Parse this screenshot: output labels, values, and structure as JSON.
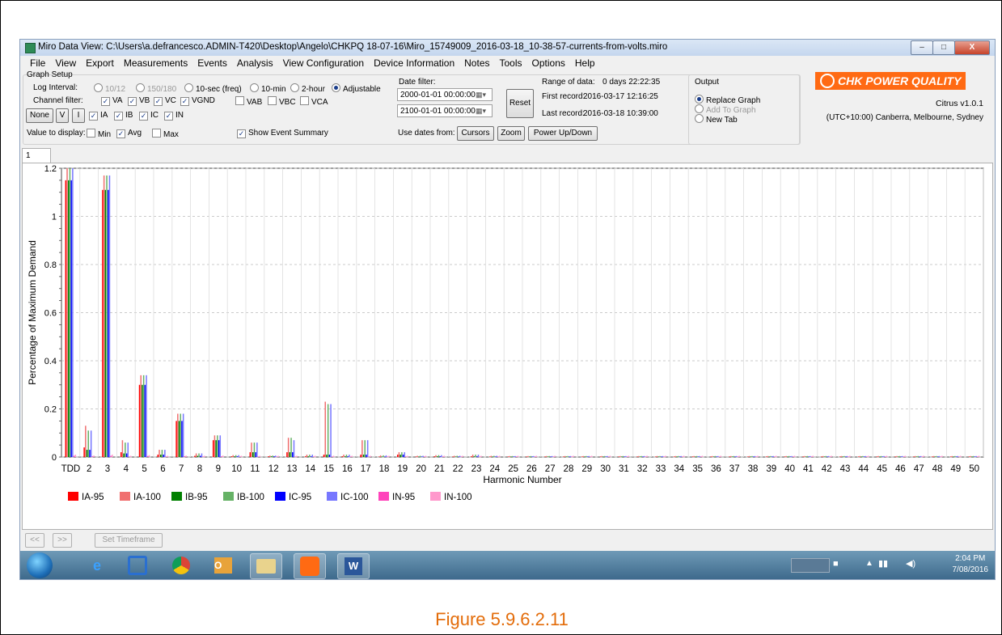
{
  "window": {
    "title": "Miro Data View: C:\\Users\\a.defrancesco.ADMIN-T420\\Desktop\\Angelo\\CHKPQ 18-07-16\\Miro_15749009_2016-03-18_10-38-57-currents-from-volts.miro",
    "min": "–",
    "max": "□",
    "close": "X"
  },
  "menu": [
    "File",
    "View",
    "Export",
    "Measurements",
    "Events",
    "Analysis",
    "View Configuration",
    "Device Information",
    "Notes",
    "Tools",
    "Options",
    "Help"
  ],
  "setup": {
    "group_title": "Graph Setup",
    "log_interval_label": "Log Interval:",
    "log_options": [
      "10/12",
      "150/180",
      "10-sec (freq)",
      "10-min",
      "2-hour",
      "Adjustable"
    ],
    "channel_filter_label": "Channel filter:",
    "channels_row1": [
      "VA",
      "VB",
      "VC",
      "VGND",
      "VAB",
      "VBC",
      "VCA"
    ],
    "channels_row2": [
      "IA",
      "IB",
      "IC",
      "IN"
    ],
    "btn_none": "None",
    "btn_v": "V",
    "btn_i": "I",
    "value_label": "Value to display:",
    "values": [
      "Min",
      "Avg",
      "Max"
    ],
    "show_event_summary": "Show Event Summary",
    "date_filter_label": "Date filter:",
    "date_from": "2000-01-01 00:00:00",
    "date_to": "2100-01-01 00:00:00",
    "reset": "Reset",
    "use_dates_label": "Use dates from:",
    "btn_cursors": "Cursors",
    "btn_zoom": "Zoom",
    "btn_power": "Power Up/Down",
    "range_label": "Range of data:",
    "range_value": "0 days 22:22:35",
    "first_label": "First record:",
    "first_value": "2016-03-17 12:16:25",
    "last_label": "Last record:",
    "last_value": "2016-03-18 10:39:00",
    "output_title": "Output",
    "output_options": [
      "Replace Graph",
      "Add To Graph",
      "New Tab"
    ],
    "logo_text": "CHK POWER QUALITY",
    "version": "Citrus v1.0.1",
    "timezone": "(UTC+10:00) Canberra, Melbourne, Sydney"
  },
  "tab_label": "1",
  "nav": {
    "prev": "<<",
    "next": ">>",
    "set_timeframe": "Set Timeframe"
  },
  "taskbar": {
    "time": "2:04 PM",
    "date": "7/08/2016"
  },
  "caption": "Figure 5.9.6.2.11",
  "colors": {
    "IA-95": "#ff0000",
    "IA-100": "#f07070",
    "IB-95": "#008000",
    "IB-100": "#66b266",
    "IC-95": "#0000ff",
    "IC-100": "#7777ff",
    "IN-95": "#ff44bb",
    "IN-100": "#ff99cc"
  },
  "chart_data": {
    "type": "bar",
    "xlabel": "Harmonic Number",
    "ylabel": "Percentage of Maximum Demand",
    "ylim": [
      0,
      1.2
    ],
    "yticks": [
      0,
      0.2,
      0.4,
      0.6,
      0.8,
      1,
      1.2
    ],
    "categories": [
      "TDD",
      "2",
      "3",
      "4",
      "5",
      "6",
      "7",
      "8",
      "9",
      "10",
      "11",
      "12",
      "13",
      "14",
      "15",
      "16",
      "17",
      "18",
      "19",
      "20",
      "21",
      "22",
      "23",
      "24",
      "25",
      "26",
      "27",
      "28",
      "29",
      "30",
      "31",
      "32",
      "33",
      "34",
      "35",
      "36",
      "37",
      "38",
      "39",
      "40",
      "41",
      "42",
      "43",
      "44",
      "45",
      "46",
      "47",
      "48",
      "49",
      "50"
    ],
    "grid": true,
    "legend_position": "bottom-left",
    "series": [
      {
        "name": "IA-95",
        "values": [
          1.15,
          0.04,
          1.11,
          0.02,
          0.3,
          0.01,
          0.15,
          0.005,
          0.07,
          0.003,
          0.02,
          0.003,
          0.02,
          0.003,
          0.01,
          0.003,
          0.01,
          0.002,
          0.01,
          0.002,
          0.003,
          0.002,
          0.003,
          0.002,
          0.002,
          0.002,
          0.002,
          0.002,
          0.002,
          0.002,
          0.002,
          0.002,
          0.002,
          0.002,
          0.002,
          0.002,
          0.002,
          0.002,
          0.002,
          0.002,
          0.002,
          0.002,
          0.002,
          0.002,
          0.002,
          0.002,
          0.002,
          0.002,
          0.002,
          0.002
        ]
      },
      {
        "name": "IA-100",
        "values": [
          1.2,
          0.13,
          1.17,
          0.07,
          0.34,
          0.03,
          0.18,
          0.015,
          0.09,
          0.008,
          0.06,
          0.006,
          0.08,
          0.01,
          0.23,
          0.01,
          0.07,
          0.007,
          0.02,
          0.005,
          0.008,
          0.005,
          0.01,
          0.005,
          0.004,
          0.004,
          0.004,
          0.004,
          0.004,
          0.004,
          0.004,
          0.004,
          0.004,
          0.004,
          0.004,
          0.004,
          0.004,
          0.004,
          0.004,
          0.004,
          0.004,
          0.004,
          0.004,
          0.004,
          0.004,
          0.004,
          0.004,
          0.004,
          0.004,
          0.004
        ]
      },
      {
        "name": "IB-95",
        "values": [
          1.15,
          0.03,
          1.11,
          0.015,
          0.3,
          0.01,
          0.15,
          0.005,
          0.07,
          0.003,
          0.02,
          0.003,
          0.02,
          0.003,
          0.01,
          0.003,
          0.01,
          0.002,
          0.01,
          0.002,
          0.003,
          0.002,
          0.003,
          0.002,
          0.002,
          0.002,
          0.002,
          0.002,
          0.002,
          0.002,
          0.002,
          0.002,
          0.002,
          0.002,
          0.002,
          0.002,
          0.002,
          0.002,
          0.002,
          0.002,
          0.002,
          0.002,
          0.002,
          0.002,
          0.002,
          0.002,
          0.002,
          0.002,
          0.002,
          0.002
        ]
      },
      {
        "name": "IB-100",
        "values": [
          1.2,
          0.11,
          1.17,
          0.06,
          0.34,
          0.03,
          0.18,
          0.015,
          0.09,
          0.008,
          0.06,
          0.006,
          0.08,
          0.01,
          0.22,
          0.01,
          0.07,
          0.007,
          0.02,
          0.005,
          0.008,
          0.005,
          0.01,
          0.005,
          0.004,
          0.004,
          0.004,
          0.004,
          0.004,
          0.004,
          0.004,
          0.004,
          0.004,
          0.004,
          0.004,
          0.004,
          0.004,
          0.004,
          0.004,
          0.004,
          0.004,
          0.004,
          0.004,
          0.004,
          0.004,
          0.004,
          0.004,
          0.004,
          0.004,
          0.004
        ]
      },
      {
        "name": "IC-95",
        "values": [
          1.15,
          0.03,
          1.11,
          0.015,
          0.3,
          0.01,
          0.15,
          0.005,
          0.07,
          0.003,
          0.02,
          0.003,
          0.02,
          0.003,
          0.01,
          0.003,
          0.01,
          0.002,
          0.01,
          0.002,
          0.003,
          0.002,
          0.003,
          0.002,
          0.002,
          0.002,
          0.002,
          0.002,
          0.002,
          0.002,
          0.002,
          0.002,
          0.002,
          0.002,
          0.002,
          0.002,
          0.002,
          0.002,
          0.002,
          0.002,
          0.002,
          0.002,
          0.002,
          0.002,
          0.002,
          0.002,
          0.002,
          0.002,
          0.002,
          0.002
        ]
      },
      {
        "name": "IC-100",
        "values": [
          1.2,
          0.11,
          1.17,
          0.06,
          0.34,
          0.03,
          0.18,
          0.015,
          0.09,
          0.008,
          0.06,
          0.006,
          0.07,
          0.01,
          0.22,
          0.01,
          0.07,
          0.007,
          0.02,
          0.005,
          0.008,
          0.005,
          0.01,
          0.005,
          0.004,
          0.004,
          0.004,
          0.004,
          0.004,
          0.004,
          0.004,
          0.004,
          0.004,
          0.004,
          0.004,
          0.004,
          0.004,
          0.004,
          0.004,
          0.004,
          0.004,
          0.004,
          0.004,
          0.004,
          0.004,
          0.004,
          0.004,
          0.004,
          0.004,
          0.004
        ]
      },
      {
        "name": "IN-95",
        "values": [
          0.005,
          0.003,
          0.005,
          0.002,
          0.004,
          0.002,
          0.003,
          0.002,
          0.003,
          0.002,
          0.002,
          0.002,
          0.002,
          0.002,
          0.002,
          0.002,
          0.002,
          0.002,
          0.002,
          0.002,
          0.002,
          0.002,
          0.002,
          0.002,
          0.002,
          0.002,
          0.002,
          0.002,
          0.002,
          0.002,
          0.002,
          0.002,
          0.002,
          0.002,
          0.002,
          0.002,
          0.002,
          0.002,
          0.002,
          0.002,
          0.002,
          0.002,
          0.002,
          0.002,
          0.002,
          0.002,
          0.002,
          0.002,
          0.002,
          0.002
        ]
      },
      {
        "name": "IN-100",
        "values": [
          0.01,
          0.006,
          0.01,
          0.005,
          0.008,
          0.005,
          0.006,
          0.005,
          0.006,
          0.005,
          0.005,
          0.005,
          0.005,
          0.005,
          0.005,
          0.005,
          0.005,
          0.005,
          0.005,
          0.005,
          0.005,
          0.005,
          0.005,
          0.005,
          0.005,
          0.005,
          0.005,
          0.005,
          0.005,
          0.005,
          0.005,
          0.005,
          0.005,
          0.005,
          0.005,
          0.005,
          0.005,
          0.005,
          0.005,
          0.005,
          0.005,
          0.005,
          0.005,
          0.005,
          0.005,
          0.005,
          0.005,
          0.005,
          0.005,
          0.005
        ]
      }
    ]
  }
}
